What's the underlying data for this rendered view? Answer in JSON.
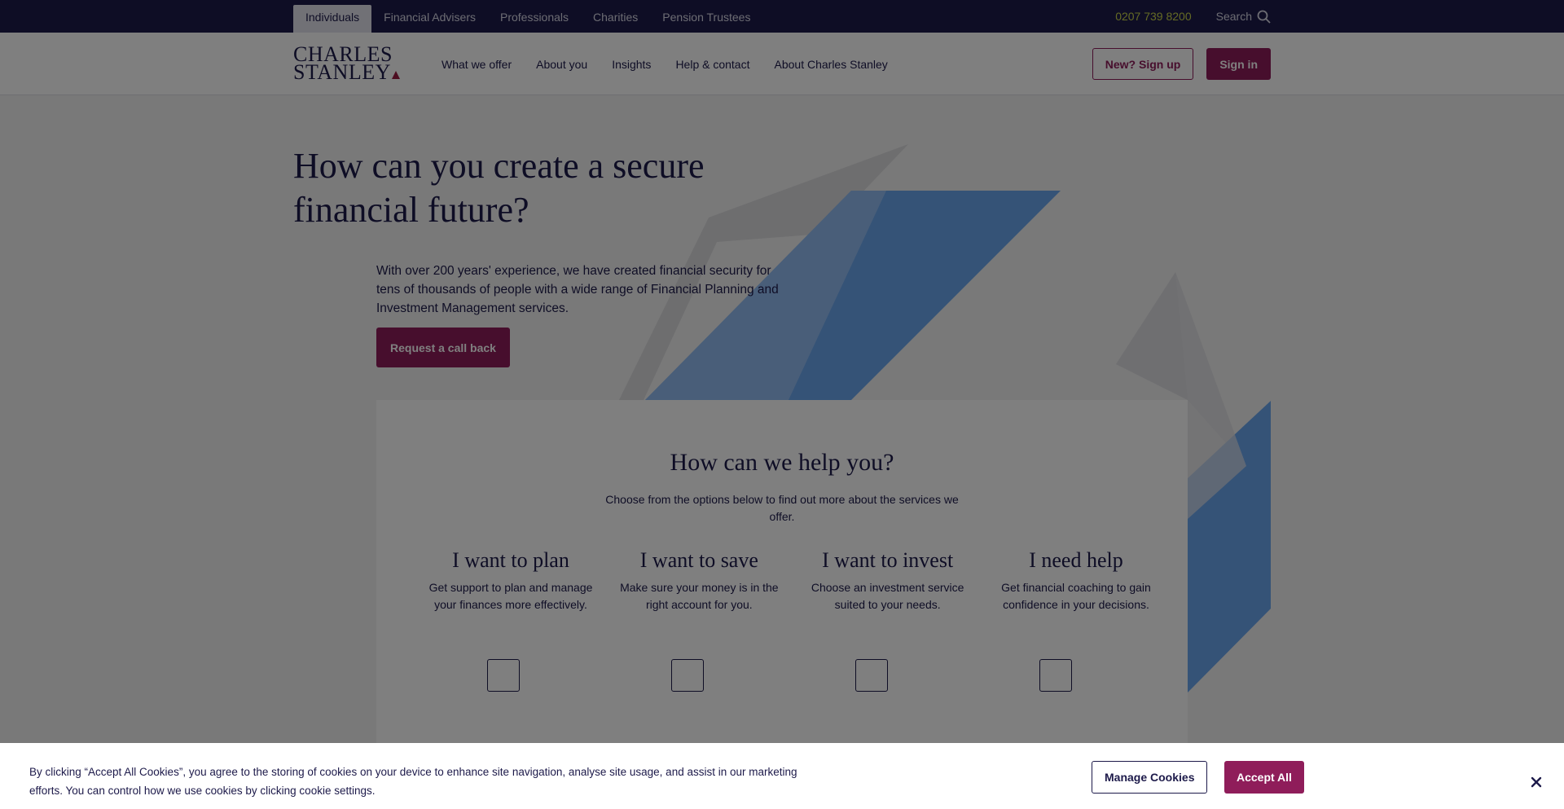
{
  "utility_bar": {
    "tabs": [
      {
        "label": "Individuals",
        "active": true
      },
      {
        "label": "Financial Advisers"
      },
      {
        "label": "Professionals"
      },
      {
        "label": "Charities"
      },
      {
        "label": "Pension Trustees"
      }
    ],
    "phone": "0207 739 8200",
    "search_label": "Search",
    "search_icon": "search-icon"
  },
  "header": {
    "logo_line1": "CHARLES",
    "logo_line2": "STANLEY",
    "nav": [
      "What we offer",
      "About you",
      "Insights",
      "Help & contact",
      "About Charles Stanley"
    ],
    "signup_label": "New? Sign up",
    "signin_label": "Sign in"
  },
  "hero": {
    "title": "How can you create a secure financial future?",
    "text": "With over 200 years' experience, we have created financial security for tens of thousands of people with a wide range of Financial Planning and Investment Management services.",
    "cta_label": "Request a call back"
  },
  "help": {
    "title": "How can we help you?",
    "subtitle": "Choose from the options below to find out more about the services we offer.",
    "options": [
      {
        "title": "I want to plan",
        "text": "Get support to plan and manage your finances more effectively."
      },
      {
        "title": "I want to save",
        "text": "Make sure your money is in the right account for you."
      },
      {
        "title": "I want to invest",
        "text": "Choose an investment service suited to your needs."
      },
      {
        "title": "I need help",
        "text": "Get financial coaching to gain confidence in your decisions."
      }
    ]
  },
  "cookie": {
    "text": "By clicking “Accept All Cookies”, you agree to the storing of cookies on your device to enhance site navigation, analyse site usage, and assist in our marketing efforts. You can control how we use cookies by clicking cookie settings.",
    "manage_label": "Manage Cookies",
    "accept_label": "Accept All",
    "close_icon": "close-icon"
  },
  "colors": {
    "navy": "#1d1a4a",
    "brand_plum": "#8f1d5a",
    "phone_yellow": "#c9d44a",
    "shape_blue": "#6aa6ef"
  }
}
